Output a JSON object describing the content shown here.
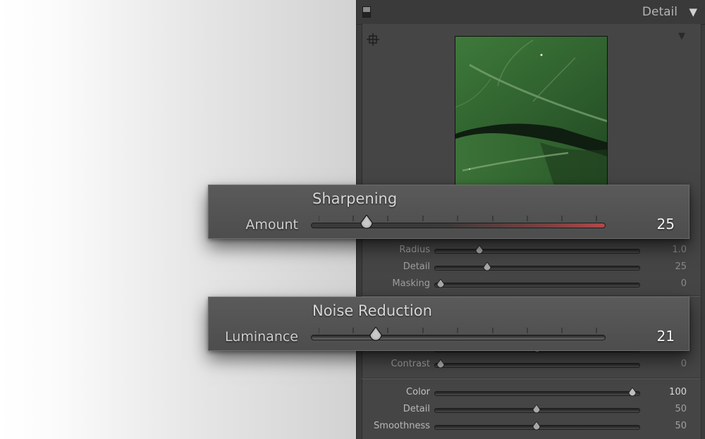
{
  "panel": {
    "title": "Detail",
    "icons": {
      "switch": "panel-switch-icon",
      "collapse": "triangle-down-icon",
      "target": "crosshair-target-icon",
      "preview_menu": "triangle-down-icon"
    }
  },
  "sharpening": {
    "heading": "Sharpening",
    "amount": {
      "label": "Amount",
      "value": "25",
      "fraction": 0.19
    },
    "sliders": [
      {
        "label": "Radius",
        "value": "1.0",
        "fraction": 0.22
      },
      {
        "label": "Detail",
        "value": "25",
        "fraction": 0.26
      },
      {
        "label": "Masking",
        "value": "0",
        "fraction": 0.03
      }
    ]
  },
  "noise_reduction": {
    "heading": "Noise Reduction",
    "luminance": {
      "label": "Luminance",
      "value": "21",
      "fraction": 0.22
    },
    "sliders": [
      {
        "label": "Contrast",
        "value": "0",
        "fraction": 0.03
      }
    ],
    "color_sliders": [
      {
        "label": "Color",
        "value": "100",
        "fraction": 0.97
      },
      {
        "label": "Detail",
        "value": "50",
        "fraction": 0.5
      },
      {
        "label": "Smoothness",
        "value": "50",
        "fraction": 0.5
      }
    ]
  },
  "colors": {
    "amount_track_accent": "#b34848",
    "panel_bg": "#454545",
    "callout_bg": "#555555"
  }
}
